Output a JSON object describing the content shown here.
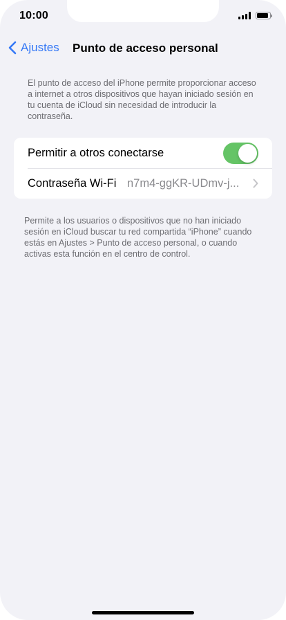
{
  "status_bar": {
    "time": "10:00",
    "battery_level": 0.9
  },
  "nav": {
    "back_label": "Ajustes",
    "title": "Punto de acceso personal"
  },
  "info_top": "El punto de acceso del iPhone permite proporcionar acceso a internet a otros dispositivos que hayan iniciado sesión en tu cuenta de iCloud sin necesidad de introducir la contraseña.",
  "settings": {
    "allow_others_label": "Permitir a otros conectarse",
    "allow_others_enabled": true,
    "wifi_password_label": "Contraseña Wi-Fi",
    "wifi_password_value": "n7m4-ggKR-UDmv-j..."
  },
  "info_bottom": "Permite a los usuarios o dispositivos que no han iniciado sesión en iCloud buscar tu red compartida “iPhone” cuando estás en Ajustes > Punto de acceso personal, o cuando activas esta función en el centro de control.",
  "colors": {
    "accent": "#3478f6",
    "toggle_on": "#65c466",
    "background": "#f2f2f7"
  },
  "icons": [
    "signal-icon",
    "battery-icon",
    "chevron-left-icon",
    "chevron-right-icon"
  ]
}
